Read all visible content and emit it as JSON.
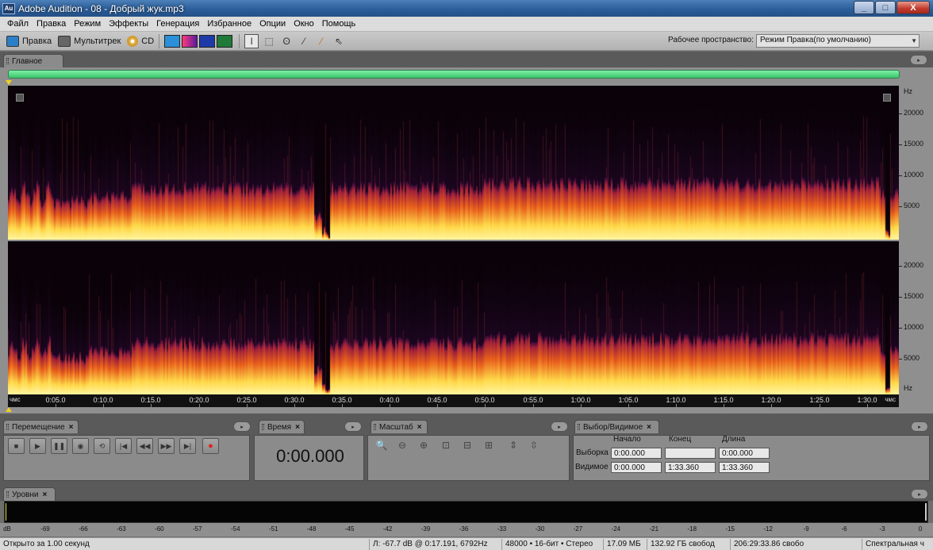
{
  "window": {
    "app_icon": "Au",
    "title": "Adobe Audition - 08 - Добрый жук.mp3",
    "minimize": "_",
    "maximize": "□",
    "close": "X"
  },
  "menu": [
    "Файл",
    "Правка",
    "Режим",
    "Эффекты",
    "Генерация",
    "Избранное",
    "Опции",
    "Окно",
    "Помощь"
  ],
  "toolbar": {
    "mode_edit": "Правка",
    "mode_multitrack": "Мультитрек",
    "mode_cd": "CD",
    "workspace_label": "Рабочее пространство:",
    "workspace_value": "Режим Правка(по умолчанию)"
  },
  "main_panel": {
    "tab": "Главное",
    "hz_unit": "Hz",
    "hz_labels": [
      "20000",
      "15000",
      "10000",
      "5000"
    ],
    "time_start_unit": "чмс",
    "time_end_unit": "чмс",
    "time_labels": [
      "0:05.0",
      "0:10.0",
      "0:15.0",
      "0:20.0",
      "0:25.0",
      "0:30.0",
      "0:35.0",
      "0:40.0",
      "0:45.0",
      "0:50.0",
      "0:55.0",
      "1:00.0",
      "1:05.0",
      "1:10.0",
      "1:15.0",
      "1:20.0",
      "1:25.0",
      "1:30.0"
    ]
  },
  "transport": {
    "tab": "Перемещение",
    "close": "×"
  },
  "time_panel": {
    "tab": "Время",
    "close": "×",
    "value": "0:00.000"
  },
  "zoom_panel": {
    "tab": "Масштаб",
    "close": "×"
  },
  "selection_panel": {
    "tab": "Выбор/Видимое",
    "close": "×",
    "col_start": "Начало",
    "col_end": "Конец",
    "col_length": "Длина",
    "row_selection": "Выборка",
    "row_view": "Видимое",
    "sel_start": "0:00.000",
    "sel_end": "",
    "sel_length": "0:00.000",
    "view_start": "0:00.000",
    "view_end": "1:33.360",
    "view_length": "1:33.360"
  },
  "levels": {
    "tab": "Уровни",
    "close": "×",
    "scale": [
      "dB",
      "-69",
      "-66",
      "-63",
      "-60",
      "-57",
      "-54",
      "-51",
      "-48",
      "-45",
      "-42",
      "-39",
      "-36",
      "-33",
      "-30",
      "-27",
      "-24",
      "-21",
      "-18",
      "-15",
      "-12",
      "-9",
      "-6",
      "-3",
      "0"
    ]
  },
  "status": {
    "opened": "Открыто за 1.00 секунд",
    "cursor": "Л: -67.7 dB @  0:17.191, 6792Hz",
    "format": "48000 • 16-бит • Стерео",
    "size": "17.09 МБ",
    "free": "132.92 ГБ свобод",
    "free_time": "206:29:33.86 свобо",
    "view": "Спектральная ч"
  },
  "colors": {
    "accent": "#3cc46b",
    "spectrogram_hot": "#ffd94a",
    "spectrogram_mid": "#e0401a",
    "spectrogram_cool": "#5a1a6a"
  }
}
